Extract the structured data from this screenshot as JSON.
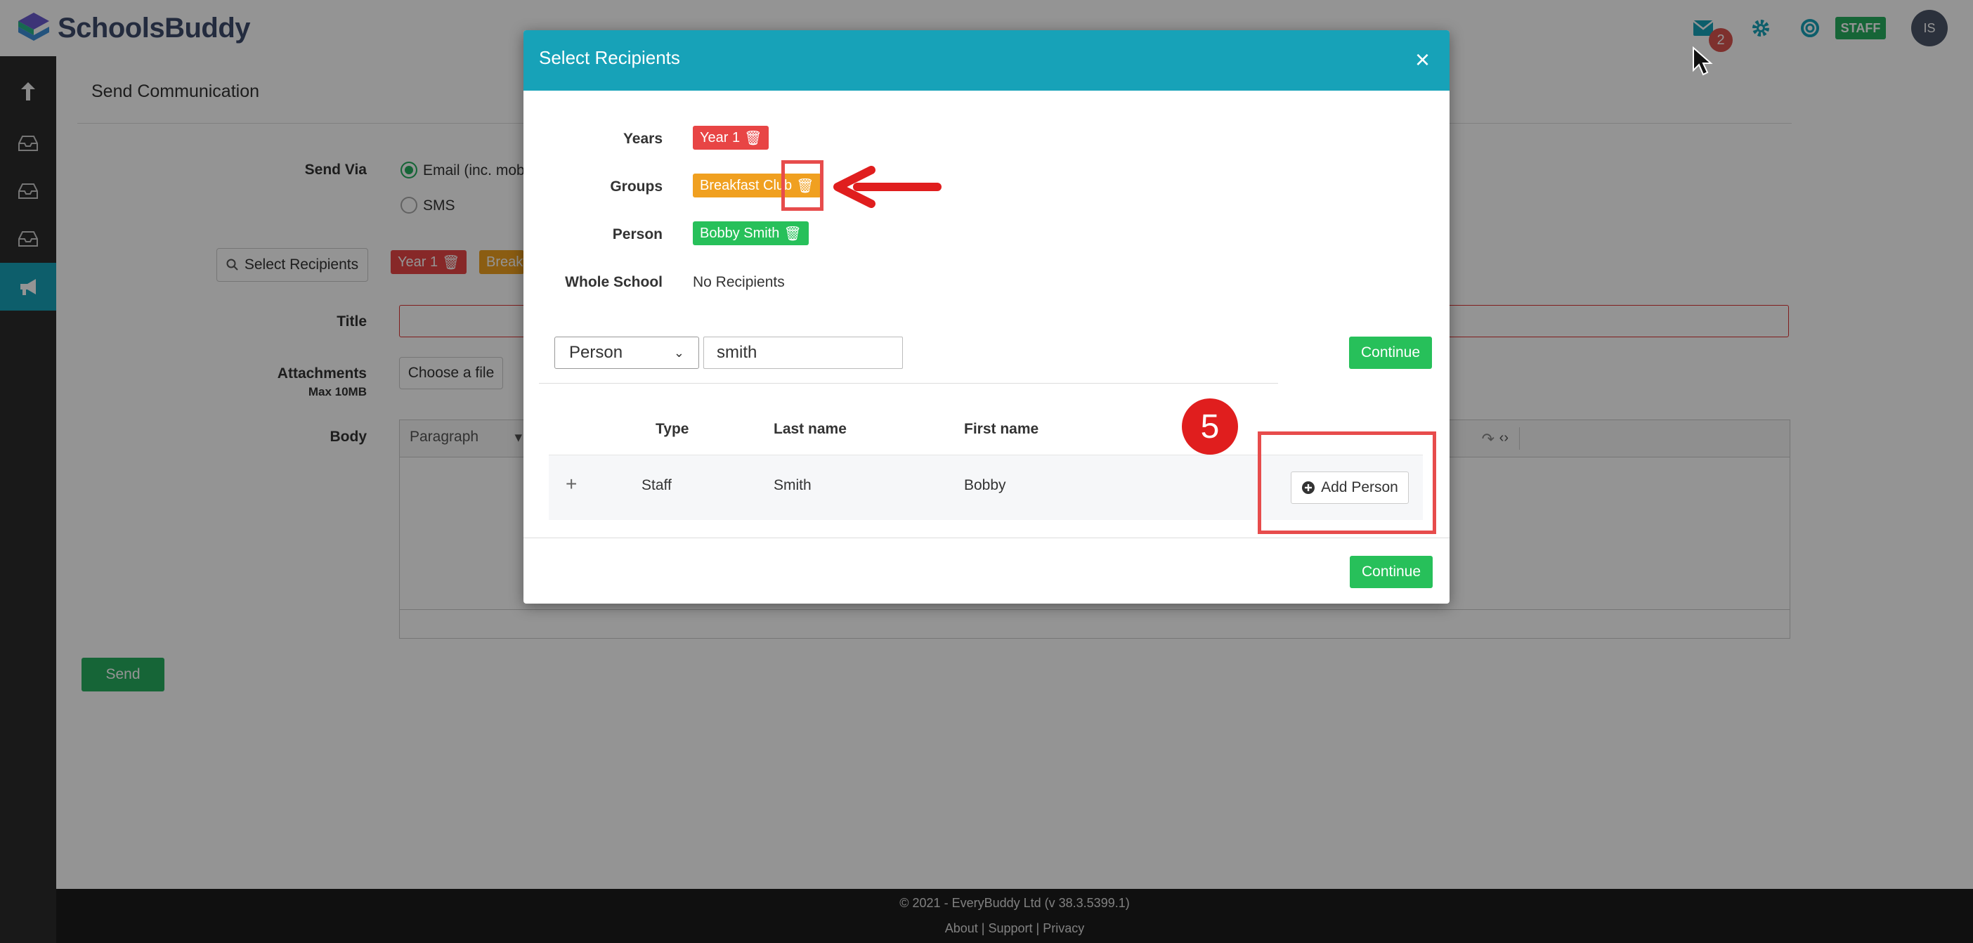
{
  "app": {
    "name": "SchoolsBuddy",
    "mail_count": "2",
    "staff_badge": "STAFF",
    "avatar_initials": "IS"
  },
  "page": {
    "title": "Send Communication",
    "send_via_label": "Send Via",
    "email_option": "Email (inc. mobi",
    "sms_option": "SMS",
    "select_recipients_button": "Select Recipients",
    "tags": [
      "Year 1",
      "Breakf"
    ],
    "title_label": "Title",
    "attachments_label": "Attachments",
    "attachments_hint": "Max 10MB",
    "choose_file_button": "Choose a file",
    "body_label": "Body",
    "paragraph_format": "Paragraph",
    "send_button": "Send"
  },
  "footer": {
    "copyright": "© 2021 - EveryBuddy Ltd (v 38.3.5399.1)",
    "links": [
      "About",
      "Support",
      "Privacy"
    ],
    "separator": "|"
  },
  "modal": {
    "title": "Select Recipients",
    "close": "×",
    "rows": [
      {
        "label": "Years",
        "tag": "Year 1",
        "color": "#e84545"
      },
      {
        "label": "Groups",
        "tag": "Breakfast Club",
        "color": "#f0a020"
      },
      {
        "label": "Person",
        "tag": "Bobby Smith",
        "color": "#27c05a"
      }
    ],
    "whole_school_label": "Whole School",
    "whole_school_value": "No Recipients",
    "search_type": "Person",
    "search_value": "smith",
    "continue_top": "Continue",
    "table": {
      "headers": [
        "Type",
        "Last name",
        "First name"
      ],
      "rows": [
        {
          "expand": "+",
          "type": "Staff",
          "last_name": "Smith",
          "first_name": "Bobby",
          "action": "Add Person"
        }
      ]
    },
    "continue_bottom": "Continue"
  },
  "annotations": {
    "step_number": "5",
    "accent_color": "#e74c4c"
  }
}
